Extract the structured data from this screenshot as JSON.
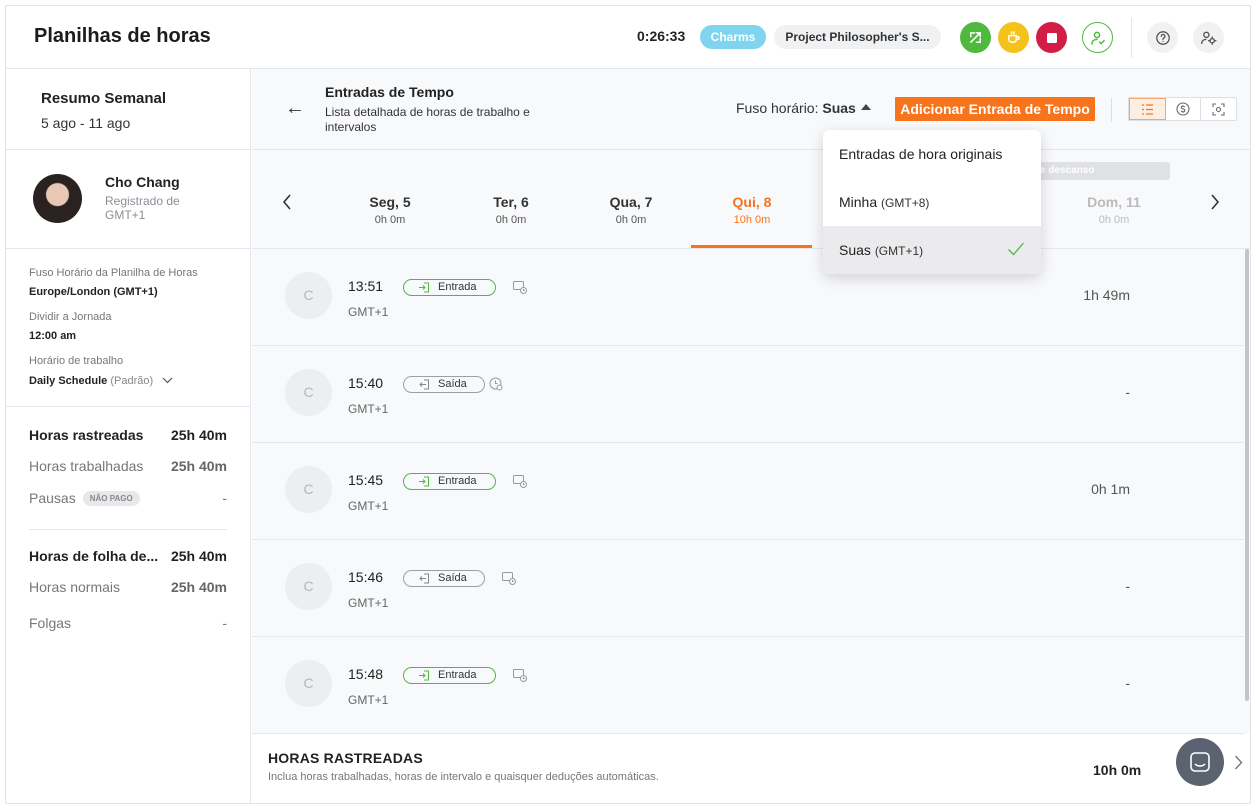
{
  "header": {
    "title": "Planilhas de horas",
    "timer": "0:26:33",
    "tag": "Charms",
    "project": "Project Philosopher's S...",
    "colors": {
      "accent": "#f7731c",
      "green": "#4fb93d",
      "yellow": "#f3c21b",
      "red": "#d21e47",
      "charms": "#7fd5ef"
    }
  },
  "sidebar": {
    "week_title": "Resumo Semanal",
    "week_range": "5 ago - 11 ago",
    "user": {
      "name": "Cho Chang",
      "sub": "Registrado de GMT+1"
    },
    "info": {
      "tz_label": "Fuso Horário da Planilha de Horas",
      "tz_value": "Europe/London (GMT+1)",
      "split_label": "Dividir a Jornada",
      "split_value": "12:00 am",
      "schedule_label": "Horário de trabalho",
      "schedule_value": "Daily Schedule",
      "schedule_default": "(Padrão)"
    },
    "stats": {
      "tracked_label": "Horas rastreadas",
      "tracked_value": "25h 40m",
      "worked_label": "Horas trabalhadas",
      "worked_value": "25h 40m",
      "breaks_label": "Pausas",
      "breaks_badge": "NÃO PAGO",
      "breaks_value": "-",
      "payroll_label": "Horas de folha de...",
      "payroll_value": "25h 40m",
      "regular_label": "Horas normais",
      "regular_value": "25h 40m",
      "timeoff_label": "Folgas",
      "timeoff_value": "-"
    }
  },
  "topbar": {
    "back": "←",
    "title": "Entradas de Tempo",
    "subtitle": "Lista detalhada de horas de trabalho e intervalos",
    "tz_prefix": "Fuso horário:",
    "tz_value": "Suas",
    "add_button": "Adicionar Entrada de Tempo",
    "views": [
      "list-icon",
      "dollar-icon",
      "scan-icon"
    ]
  },
  "days": [
    {
      "name": "Seg, 5",
      "hours": "0h 0m"
    },
    {
      "name": "Ter, 6",
      "hours": "0h 0m"
    },
    {
      "name": "Qua, 7",
      "hours": "0h 0m"
    },
    {
      "name": "Qui, 8",
      "hours": "10h 0m"
    },
    {
      "name": "Dom, 11",
      "hours": "0h 0m"
    }
  ],
  "rest_chip": "e descanso",
  "entries": [
    {
      "initial": "C",
      "time": "13:51",
      "tz": "GMT+1",
      "type": "Entrada",
      "duration": "1h 49m"
    },
    {
      "initial": "C",
      "time": "15:40",
      "tz": "GMT+1",
      "type": "Saída",
      "duration": "-"
    },
    {
      "initial": "C",
      "time": "15:45",
      "tz": "GMT+1",
      "type": "Entrada",
      "duration": "0h 1m"
    },
    {
      "initial": "C",
      "time": "15:46",
      "tz": "GMT+1",
      "type": "Saída",
      "duration": "-"
    },
    {
      "initial": "C",
      "time": "15:48",
      "tz": "GMT+1",
      "type": "Entrada",
      "duration": "-"
    }
  ],
  "footer": {
    "title": "HORAS RASTREADAS",
    "subtitle": "Inclua horas trabalhadas, horas de intervalo e quaisquer deduções automáticas.",
    "total": "10h 0m"
  },
  "dropdown": {
    "items": [
      {
        "label": "Entradas de hora originais",
        "tz": ""
      },
      {
        "label": "Minha",
        "tz": "(GMT+8)"
      },
      {
        "label": "Suas",
        "tz": "(GMT+1)",
        "selected": true
      }
    ]
  }
}
